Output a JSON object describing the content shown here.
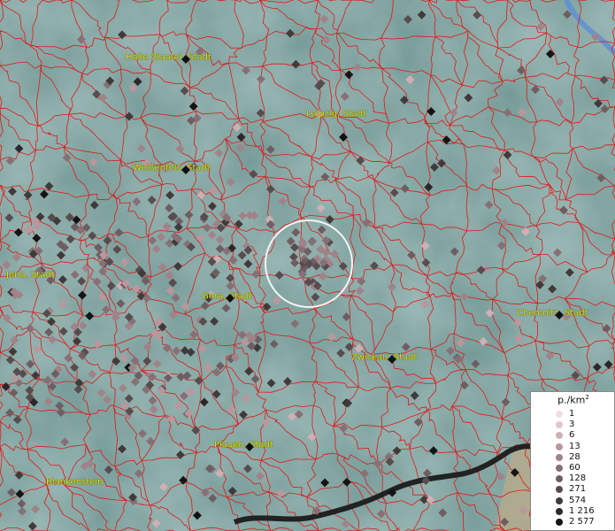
{
  "map": {
    "cities": [
      {
        "name": "Halle (Saale), Stadt"
      },
      {
        "name": "Leipzig, Stadt"
      },
      {
        "name": "Weißenfels, Stadt"
      },
      {
        "name": "Jena, Stadt"
      },
      {
        "name": "Gera, Stadt"
      },
      {
        "name": "Chemnitz, Stadt"
      },
      {
        "name": "Zwickau, Stadt"
      },
      {
        "name": "Plauen, Stadt"
      },
      {
        "name": "Blankenstein"
      }
    ]
  },
  "legend": {
    "title": "p./km",
    "title_sup": "2",
    "entries": [
      {
        "label": "1",
        "color": "#f2dde0"
      },
      {
        "label": "3",
        "color": "#e2c6ca"
      },
      {
        "label": "6",
        "color": "#cfb0b5"
      },
      {
        "label": "13",
        "color": "#b9979d"
      },
      {
        "label": "28",
        "color": "#a08389"
      },
      {
        "label": "60",
        "color": "#877075"
      },
      {
        "label": "128",
        "color": "#6e5e61"
      },
      {
        "label": "271",
        "color": "#574c4e"
      },
      {
        "label": "574",
        "color": "#413a3b"
      },
      {
        "label": "1 216",
        "color": "#2c2829"
      },
      {
        "label": "2 577",
        "color": "#151415"
      }
    ]
  },
  "colors": {
    "boundary": "#e01818",
    "terrain": "#7fa3a0",
    "label": "#e2e200",
    "highlight_circle": "#ffffff"
  }
}
